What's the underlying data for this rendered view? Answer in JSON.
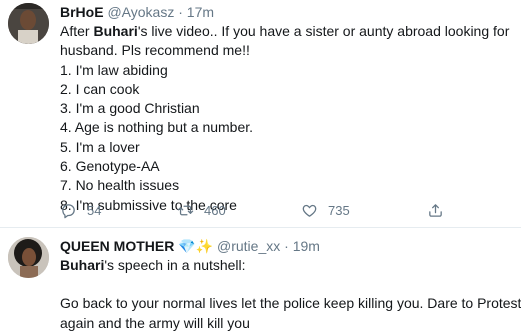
{
  "tweets": [
    {
      "display_name": "BrHoE",
      "handle": "@Ayokasz",
      "separator": "·",
      "time": "17m",
      "text_line1_pre": "After ",
      "text_line1_bold": "Buhari",
      "text_line1_post": "'s live video.. If you have a sister or aunty abroad looking for",
      "text_line2": "husband. Pls recommend me!!",
      "list": [
        "1. I'm law abiding",
        "2. I can cook",
        "3. I'm a good Christian",
        "4. Age is nothing but a number.",
        "5. I'm a lover",
        "6. Genotype-AA",
        "7. No health issues",
        "8. I'm submissive to the core"
      ],
      "replies": "54",
      "retweets": "460",
      "likes": "735",
      "icons": [
        "reply-icon",
        "retweet-icon",
        "like-icon",
        "share-icon"
      ]
    },
    {
      "display_name": "QUEEN MOTHER",
      "badges": "💎✨",
      "handle": "@rutie_xx",
      "separator": "·",
      "time": "19m",
      "line1_bold": "Buhari",
      "line1_post": "'s speech in a nutshell:",
      "para_line1": "Go back to your normal lives let the police keep killing you. Dare to Protest",
      "para_line2": "again and the army will kill you"
    }
  ],
  "colors": {
    "text": "#14171a",
    "muted": "#657786",
    "border": "#e6ecf0"
  }
}
